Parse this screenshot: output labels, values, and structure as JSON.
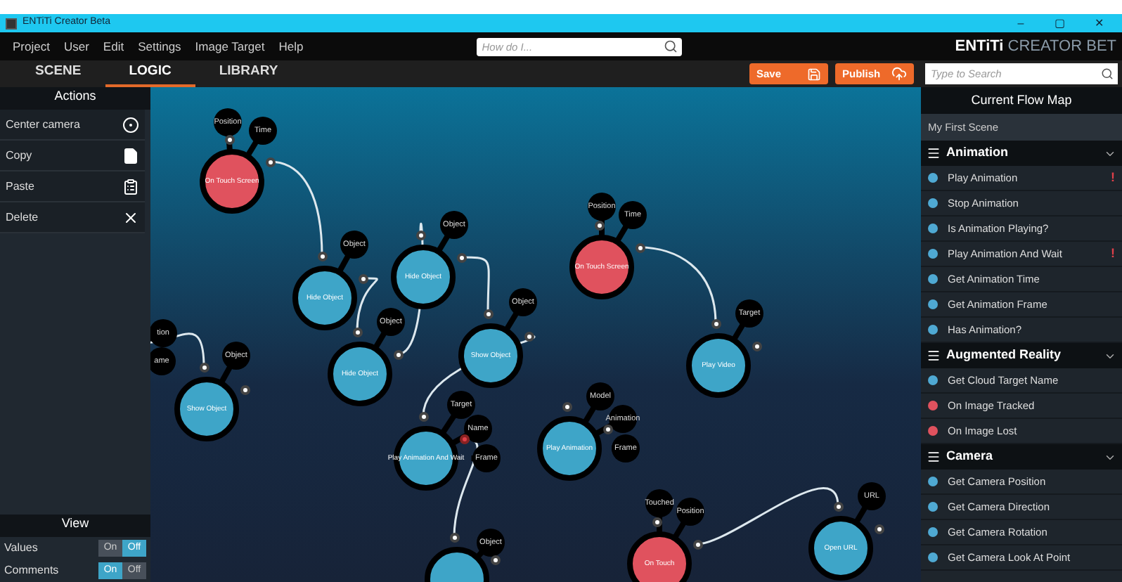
{
  "window": {
    "title": "ENTiTi Creator Beta",
    "controls": [
      "–",
      "▢",
      "✕"
    ]
  },
  "menu": [
    "Project",
    "User",
    "Edit",
    "Settings",
    "Image Target",
    "Help"
  ],
  "help_search": {
    "placeholder": "How do I..."
  },
  "brand": {
    "bold": "ENTiTi",
    "light": "CREATOR BET"
  },
  "tabs": [
    {
      "label": "SCENE",
      "selected": false
    },
    {
      "label": "LOGIC",
      "selected": true
    },
    {
      "label": "LIBRARY",
      "selected": false
    }
  ],
  "toolbar": {
    "buttons": [
      {
        "label": "Save",
        "kind": "save"
      },
      {
        "label": "Publish",
        "kind": "publish"
      }
    ],
    "search": {
      "placeholder": "Type to Search"
    }
  },
  "actions": {
    "title": "Actions",
    "items": [
      {
        "label": "Center camera",
        "kind": "target"
      },
      {
        "label": "Copy",
        "kind": "copy"
      },
      {
        "label": "Paste",
        "kind": "paste"
      },
      {
        "label": "Delete",
        "kind": "delete"
      }
    ]
  },
  "view": {
    "title": "View",
    "toggles": [
      {
        "label": "Values",
        "options": [
          {
            "label": "On",
            "selected": false
          },
          {
            "label": "Off",
            "selected": true
          }
        ]
      },
      {
        "label": "Comments",
        "options": [
          {
            "label": "On",
            "selected": true
          },
          {
            "label": "Off",
            "selected": false
          }
        ]
      }
    ]
  },
  "canvas": {
    "nodes": [
      {
        "label": "On Touch Screen",
        "kind": "event",
        "ports": [
          "Position",
          "Time"
        ]
      },
      {
        "label": "Hide Object",
        "kind": "action",
        "ports": [
          "Object"
        ]
      },
      {
        "label": "Hide Object",
        "kind": "action",
        "ports": [
          "Object"
        ]
      },
      {
        "label": "Hide Object",
        "kind": "action",
        "ports": [
          "Object"
        ]
      },
      {
        "label": "Show Object",
        "kind": "action",
        "ports": [
          "Object"
        ]
      },
      {
        "label": "Show Object",
        "kind": "action",
        "ports": [
          "Object"
        ]
      },
      {
        "label": "Play Animation And Wait",
        "kind": "action",
        "ports": [
          "Target",
          "Name",
          "Frame"
        ],
        "warning": true
      },
      {
        "kind": "action",
        "ports": [
          "Object"
        ]
      },
      {
        "label": "On Touch Screen",
        "kind": "event",
        "ports": [
          "Position",
          "Time"
        ]
      },
      {
        "label": "Play Video",
        "kind": "action",
        "ports": [
          "Target"
        ]
      },
      {
        "label": "Play Animation",
        "kind": "action",
        "ports": [
          "Model",
          "Animation",
          "Frame"
        ]
      },
      {
        "label": "On Touch",
        "kind": "event",
        "ports": [
          "Touched",
          "Position"
        ]
      },
      {
        "label": "Open URL",
        "kind": "action",
        "ports": [
          "URL"
        ]
      },
      {
        "kind": "offscreen",
        "ports": [
          "tion",
          "ame"
        ]
      }
    ]
  },
  "flow_map": {
    "title": "Current Flow Map",
    "scene": "My First Scene",
    "sections": [
      {
        "title": "Animation",
        "expanded": true,
        "items": [
          {
            "label": "Play Animation",
            "color": "#4fa9d3",
            "flag": "!"
          },
          {
            "label": "Stop Animation",
            "color": "#4fa9d3"
          },
          {
            "label": "Is Animation Playing?",
            "color": "#4fa9d3"
          },
          {
            "label": "Play Animation And Wait",
            "color": "#4fa9d3",
            "flag": "!"
          },
          {
            "label": "Get Animation Time",
            "color": "#4fa9d3"
          },
          {
            "label": "Get Animation Frame",
            "color": "#4fa9d3"
          },
          {
            "label": "Has Animation?",
            "color": "#4fa9d3"
          }
        ]
      },
      {
        "title": "Augmented Reality",
        "expanded": true,
        "items": [
          {
            "label": "Get Cloud Target Name",
            "color": "#4fa9d3"
          },
          {
            "label": "On Image Tracked",
            "color": "#e0525e"
          },
          {
            "label": "On Image Lost",
            "color": "#e0525e"
          }
        ]
      },
      {
        "title": "Camera",
        "expanded": true,
        "items": [
          {
            "label": "Get Camera Position",
            "color": "#4fa9d3"
          },
          {
            "label": "Get Camera Direction",
            "color": "#4fa9d3"
          },
          {
            "label": "Get Camera Rotation",
            "color": "#4fa9d3"
          },
          {
            "label": "Get Camera Look At Point",
            "color": "#4fa9d3"
          }
        ]
      }
    ]
  }
}
